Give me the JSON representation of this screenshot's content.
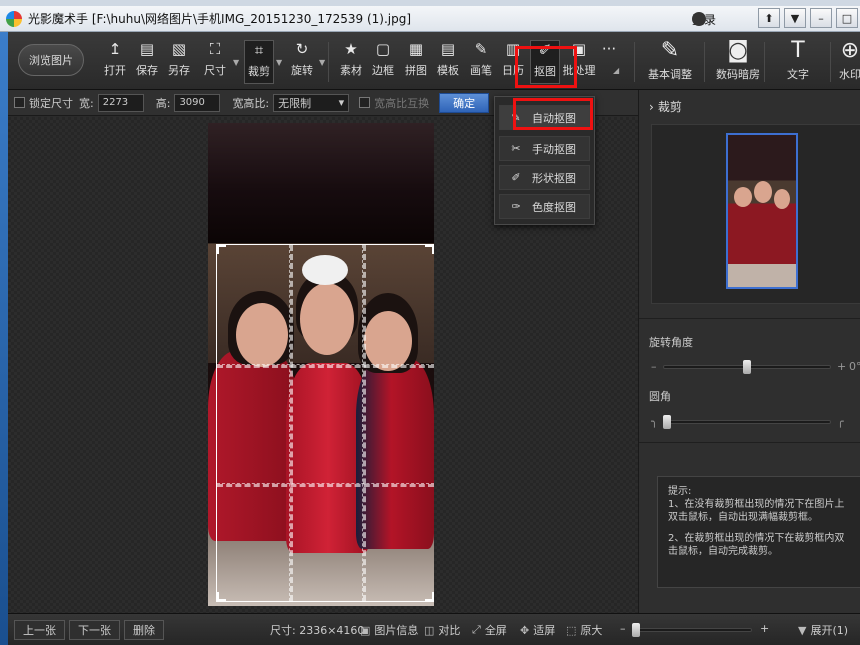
{
  "window": {
    "title": "光影魔术手  [F:\\huhu\\网络图片\\手机IMG_20151230_172539 (1).jpg]",
    "login_label": "登录",
    "controls": [
      "⬆",
      "▼",
      "–",
      "□"
    ]
  },
  "toolbar": {
    "browse_label": "浏览图片",
    "tools": [
      {
        "name": "open",
        "label": "打开",
        "icon": "↥"
      },
      {
        "name": "save",
        "label": "保存",
        "icon": "▤"
      },
      {
        "name": "save-as",
        "label": "另存",
        "icon": "▧"
      },
      {
        "name": "size",
        "label": "尺寸",
        "icon": "⛶"
      },
      {
        "name": "crop",
        "label": "裁剪",
        "icon": "⌗"
      },
      {
        "name": "rotate",
        "label": "旋转",
        "icon": "↻"
      },
      {
        "name": "material",
        "label": "素材",
        "icon": "★"
      },
      {
        "name": "border",
        "label": "边框",
        "icon": "▢"
      },
      {
        "name": "collage",
        "label": "拼图",
        "icon": "▦"
      },
      {
        "name": "template",
        "label": "模板",
        "icon": "▤"
      },
      {
        "name": "brush",
        "label": "画笔",
        "icon": "✎"
      },
      {
        "name": "calendar",
        "label": "日历",
        "icon": "▥"
      },
      {
        "name": "cutout",
        "label": "抠图",
        "icon": "✐"
      },
      {
        "name": "batch",
        "label": "批处理",
        "icon": "▣"
      }
    ],
    "more_label": "···",
    "panels": [
      {
        "name": "basic-adjust",
        "label": "基本调整",
        "icon": "✎"
      },
      {
        "name": "digital-darkroom",
        "label": "数码暗房",
        "icon": "◙"
      },
      {
        "name": "text",
        "label": "文字",
        "icon": "T"
      },
      {
        "name": "watermark",
        "label": "水印",
        "icon": "⊕"
      }
    ]
  },
  "subbar": {
    "lock_size_label": "锁定尺寸",
    "width_label": "宽:",
    "width_value": "2273",
    "height_label": "高:",
    "height_value": "3090",
    "ratio_label": "宽高比:",
    "ratio_value": "无限制",
    "swap_label": "宽高比互换",
    "confirm_label": "确定"
  },
  "cutout_menu": {
    "items": [
      {
        "label": "自动抠图",
        "icon": "✎"
      },
      {
        "label": "手动抠图",
        "icon": "✂"
      },
      {
        "label": "形状抠图",
        "icon": "✐"
      },
      {
        "label": "色度抠图",
        "icon": "✑"
      }
    ]
  },
  "right_panel": {
    "title": "裁剪",
    "rotate_label": "旋转角度",
    "rotate_value": "0°",
    "rotate_level": 0.5,
    "corner_label": "圆角",
    "corner_level": 0.0,
    "tips_title": "提示:",
    "tips_1": "1、在没有裁剪框出现的情况下在图片上双击鼠标，自动出现满幅裁剪框。",
    "tips_2": "2、在裁剪框出现的情况下在裁剪框内双击鼠标，自动完成裁剪。"
  },
  "bottombar": {
    "prev_label": "上一张",
    "next_label": "下一张",
    "delete_label": "删除",
    "size_text": "尺寸: 2336×4160",
    "info_label": "图片信息",
    "compare_label": "对比",
    "fullscreen_label": "全屏",
    "fit_label": "适屏",
    "original_label": "原大",
    "zoom_level": 0.0,
    "expand_label": "展开(1)"
  }
}
